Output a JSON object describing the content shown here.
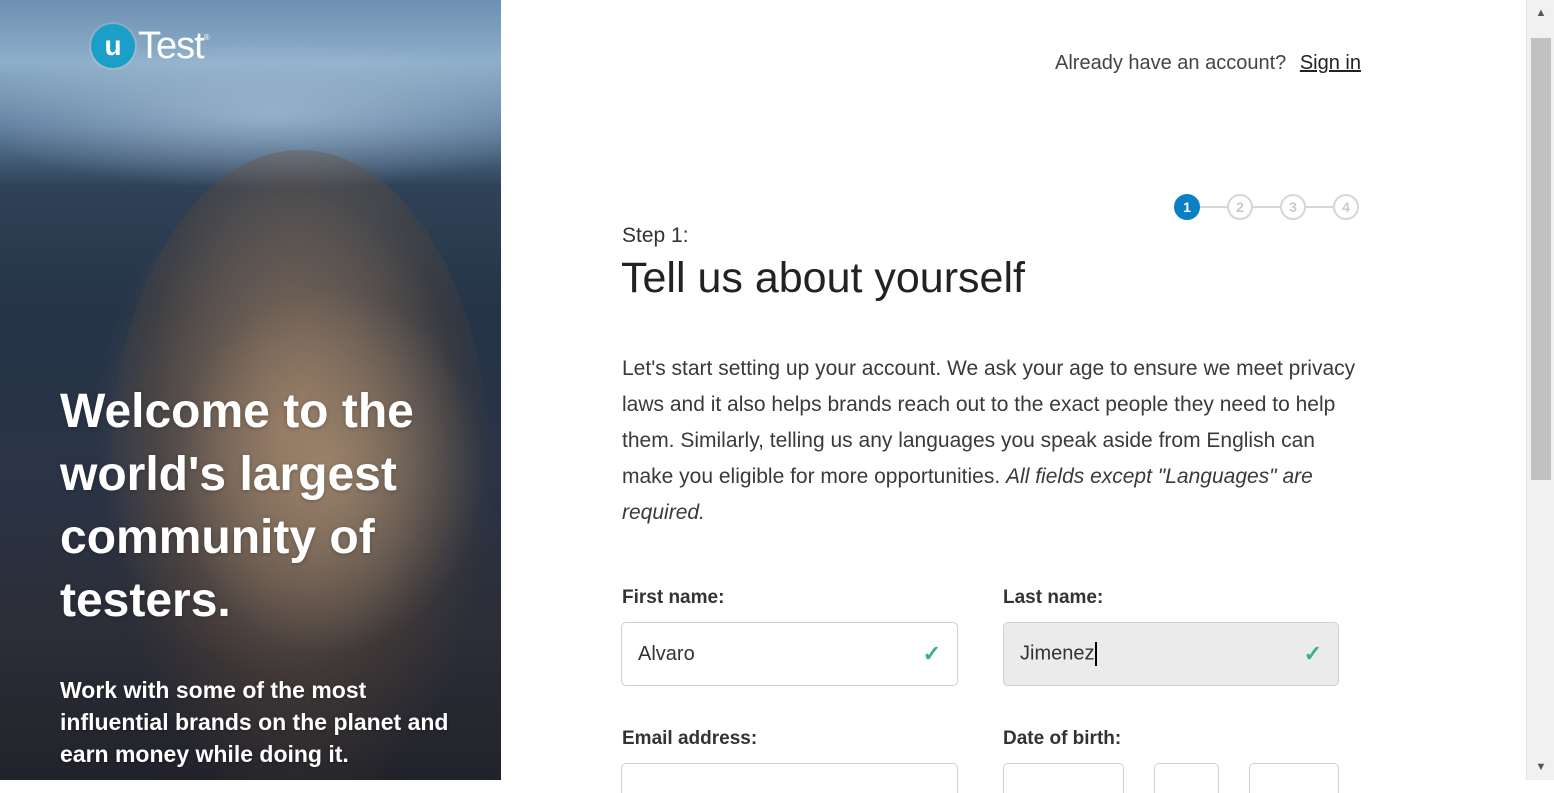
{
  "brand": {
    "badge": "u",
    "word": "Test",
    "reg": "®"
  },
  "hero": {
    "title": "Welcome to the world's largest community of testers.",
    "subtitle": "Work with some of the most influential brands on the planet and earn money while doing it."
  },
  "header": {
    "prompt": "Already have an account?",
    "signin": "Sign in"
  },
  "steps": {
    "items": [
      "1",
      "2",
      "3",
      "4"
    ],
    "active": 1
  },
  "form": {
    "step_label": "Step 1:",
    "title": "Tell us about yourself",
    "intro": "Let's start setting up your account. We ask your age to ensure we meet privacy laws and it also helps brands reach out to the exact people they need to help them. Similarly, telling us any languages you speak aside from English can make you eligible for more opportunities.",
    "intro_note": "All fields except \"Languages\" are required.",
    "first_name_label": "First name:",
    "first_name_value": "Alvaro",
    "last_name_label": "Last name:",
    "last_name_value": "Jimenez",
    "email_label": "Email address:",
    "dob_label": "Date of birth:",
    "check_icon": "✓"
  },
  "colors": {
    "accent": "#0a7fc6",
    "brand": "#1a9fc8",
    "valid": "#36b37e"
  }
}
